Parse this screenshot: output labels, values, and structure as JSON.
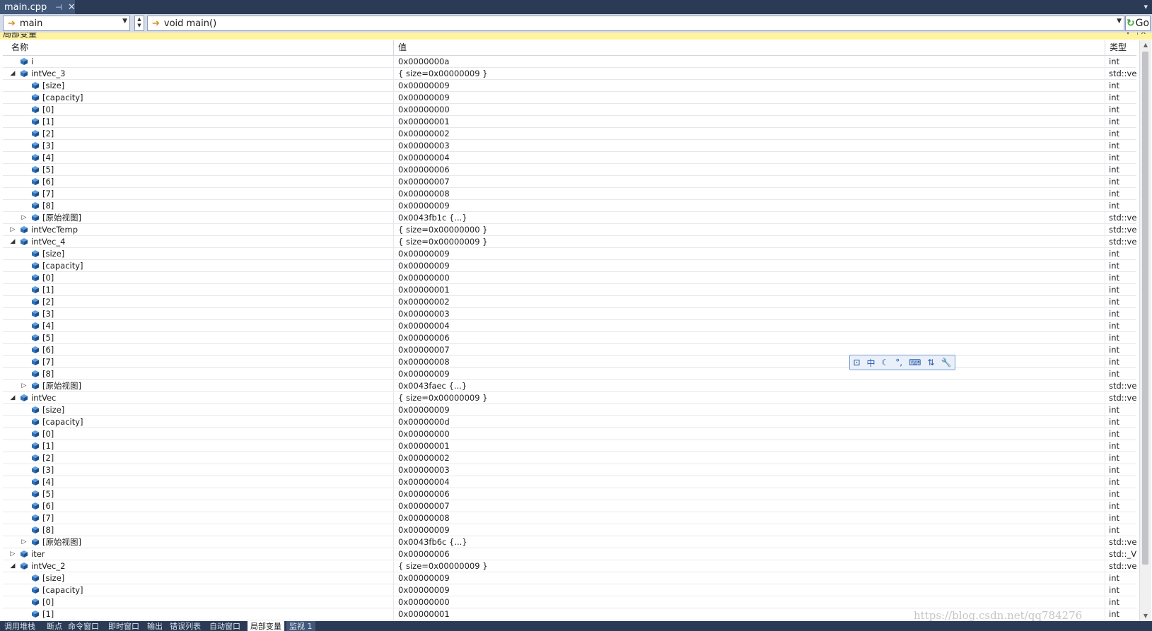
{
  "titlebar": {
    "tab_name": "main.cpp",
    "pin_glyph": "⊣",
    "close_glyph": "✕"
  },
  "navbar": {
    "scope_value": "main",
    "function_value": "void main()",
    "go_label": "Go"
  },
  "locals_window": {
    "title": "局部变量",
    "columns": {
      "name": "名称",
      "value": "值",
      "type": "类型"
    }
  },
  "rows": [
    {
      "level": 1,
      "exp": "none",
      "name": "i",
      "value": "0x0000000a",
      "type": "int"
    },
    {
      "level": 1,
      "exp": "expanded",
      "name": "intVec_3",
      "value": "{ size=0x00000009 }",
      "type": "std::vect"
    },
    {
      "level": 2,
      "exp": "none",
      "name": "[size]",
      "value": "0x00000009",
      "type": "int"
    },
    {
      "level": 2,
      "exp": "none",
      "name": "[capacity]",
      "value": "0x00000009",
      "type": "int"
    },
    {
      "level": 2,
      "exp": "none",
      "name": "[0]",
      "value": "0x00000000",
      "type": "int"
    },
    {
      "level": 2,
      "exp": "none",
      "name": "[1]",
      "value": "0x00000001",
      "type": "int"
    },
    {
      "level": 2,
      "exp": "none",
      "name": "[2]",
      "value": "0x00000002",
      "type": "int"
    },
    {
      "level": 2,
      "exp": "none",
      "name": "[3]",
      "value": "0x00000003",
      "type": "int"
    },
    {
      "level": 2,
      "exp": "none",
      "name": "[4]",
      "value": "0x00000004",
      "type": "int"
    },
    {
      "level": 2,
      "exp": "none",
      "name": "[5]",
      "value": "0x00000006",
      "type": "int"
    },
    {
      "level": 2,
      "exp": "none",
      "name": "[6]",
      "value": "0x00000007",
      "type": "int"
    },
    {
      "level": 2,
      "exp": "none",
      "name": "[7]",
      "value": "0x00000008",
      "type": "int"
    },
    {
      "level": 2,
      "exp": "none",
      "name": "[8]",
      "value": "0x00000009",
      "type": "int"
    },
    {
      "level": 2,
      "exp": "collapsed",
      "name": "[原始视图]",
      "value": "0x0043fb1c {...}",
      "type": "std::vect"
    },
    {
      "level": 1,
      "exp": "collapsed",
      "name": "intVecTemp",
      "value": "{ size=0x00000000 }",
      "type": "std::vect"
    },
    {
      "level": 1,
      "exp": "expanded",
      "name": "intVec_4",
      "value": "{ size=0x00000009 }",
      "type": "std::vect"
    },
    {
      "level": 2,
      "exp": "none",
      "name": "[size]",
      "value": "0x00000009",
      "type": "int"
    },
    {
      "level": 2,
      "exp": "none",
      "name": "[capacity]",
      "value": "0x00000009",
      "type": "int"
    },
    {
      "level": 2,
      "exp": "none",
      "name": "[0]",
      "value": "0x00000000",
      "type": "int"
    },
    {
      "level": 2,
      "exp": "none",
      "name": "[1]",
      "value": "0x00000001",
      "type": "int"
    },
    {
      "level": 2,
      "exp": "none",
      "name": "[2]",
      "value": "0x00000002",
      "type": "int"
    },
    {
      "level": 2,
      "exp": "none",
      "name": "[3]",
      "value": "0x00000003",
      "type": "int"
    },
    {
      "level": 2,
      "exp": "none",
      "name": "[4]",
      "value": "0x00000004",
      "type": "int"
    },
    {
      "level": 2,
      "exp": "none",
      "name": "[5]",
      "value": "0x00000006",
      "type": "int"
    },
    {
      "level": 2,
      "exp": "none",
      "name": "[6]",
      "value": "0x00000007",
      "type": "int"
    },
    {
      "level": 2,
      "exp": "none",
      "name": "[7]",
      "value": "0x00000008",
      "type": "int"
    },
    {
      "level": 2,
      "exp": "none",
      "name": "[8]",
      "value": "0x00000009",
      "type": "int"
    },
    {
      "level": 2,
      "exp": "collapsed",
      "name": "[原始视图]",
      "value": "0x0043faec {...}",
      "type": "std::vect"
    },
    {
      "level": 1,
      "exp": "expanded",
      "name": "intVec",
      "value": "{ size=0x00000009 }",
      "type": "std::vect"
    },
    {
      "level": 2,
      "exp": "none",
      "name": "[size]",
      "value": "0x00000009",
      "type": "int"
    },
    {
      "level": 2,
      "exp": "none",
      "name": "[capacity]",
      "value": "0x0000000d",
      "type": "int"
    },
    {
      "level": 2,
      "exp": "none",
      "name": "[0]",
      "value": "0x00000000",
      "type": "int"
    },
    {
      "level": 2,
      "exp": "none",
      "name": "[1]",
      "value": "0x00000001",
      "type": "int"
    },
    {
      "level": 2,
      "exp": "none",
      "name": "[2]",
      "value": "0x00000002",
      "type": "int"
    },
    {
      "level": 2,
      "exp": "none",
      "name": "[3]",
      "value": "0x00000003",
      "type": "int"
    },
    {
      "level": 2,
      "exp": "none",
      "name": "[4]",
      "value": "0x00000004",
      "type": "int"
    },
    {
      "level": 2,
      "exp": "none",
      "name": "[5]",
      "value": "0x00000006",
      "type": "int"
    },
    {
      "level": 2,
      "exp": "none",
      "name": "[6]",
      "value": "0x00000007",
      "type": "int"
    },
    {
      "level": 2,
      "exp": "none",
      "name": "[7]",
      "value": "0x00000008",
      "type": "int"
    },
    {
      "level": 2,
      "exp": "none",
      "name": "[8]",
      "value": "0x00000009",
      "type": "int"
    },
    {
      "level": 2,
      "exp": "collapsed",
      "name": "[原始视图]",
      "value": "0x0043fb6c {...}",
      "type": "std::vect"
    },
    {
      "level": 1,
      "exp": "collapsed",
      "name": "iter",
      "value": "0x00000006",
      "type": "std::_Vec"
    },
    {
      "level": 1,
      "exp": "expanded",
      "name": "intVec_2",
      "value": "{ size=0x00000009 }",
      "type": "std::vect"
    },
    {
      "level": 2,
      "exp": "none",
      "name": "[size]",
      "value": "0x00000009",
      "type": "int"
    },
    {
      "level": 2,
      "exp": "none",
      "name": "[capacity]",
      "value": "0x00000009",
      "type": "int"
    },
    {
      "level": 2,
      "exp": "none",
      "name": "[0]",
      "value": "0x00000000",
      "type": "int"
    },
    {
      "level": 2,
      "exp": "none",
      "name": "[1]",
      "value": "0x00000001",
      "type": "int"
    }
  ],
  "ime_toolbar": {
    "items": [
      "⊡",
      "中",
      "☾",
      "°,",
      "⌨",
      "⇅",
      "🔧"
    ]
  },
  "bottom_tabs": [
    {
      "label": "调用堆栈",
      "state": "normal"
    },
    {
      "label": "断点",
      "state": "normal"
    },
    {
      "label": "命令窗口",
      "state": "normal"
    },
    {
      "label": "即时窗口",
      "state": "normal"
    },
    {
      "label": "输出",
      "state": "normal"
    },
    {
      "label": "错误列表",
      "state": "normal"
    },
    {
      "label": "自动窗口",
      "state": "normal"
    },
    {
      "label": "局部变量",
      "state": "active"
    },
    {
      "label": "监视 1",
      "state": "alt"
    }
  ],
  "watermark": "https://blog.csdn.net/qq784276",
  "colors": {
    "title_bg": "#2b3a55",
    "locals_header_bg": "#fff3a0",
    "cube_blue": "#2f6fb5",
    "nav_arrow": "#d98c1a"
  }
}
